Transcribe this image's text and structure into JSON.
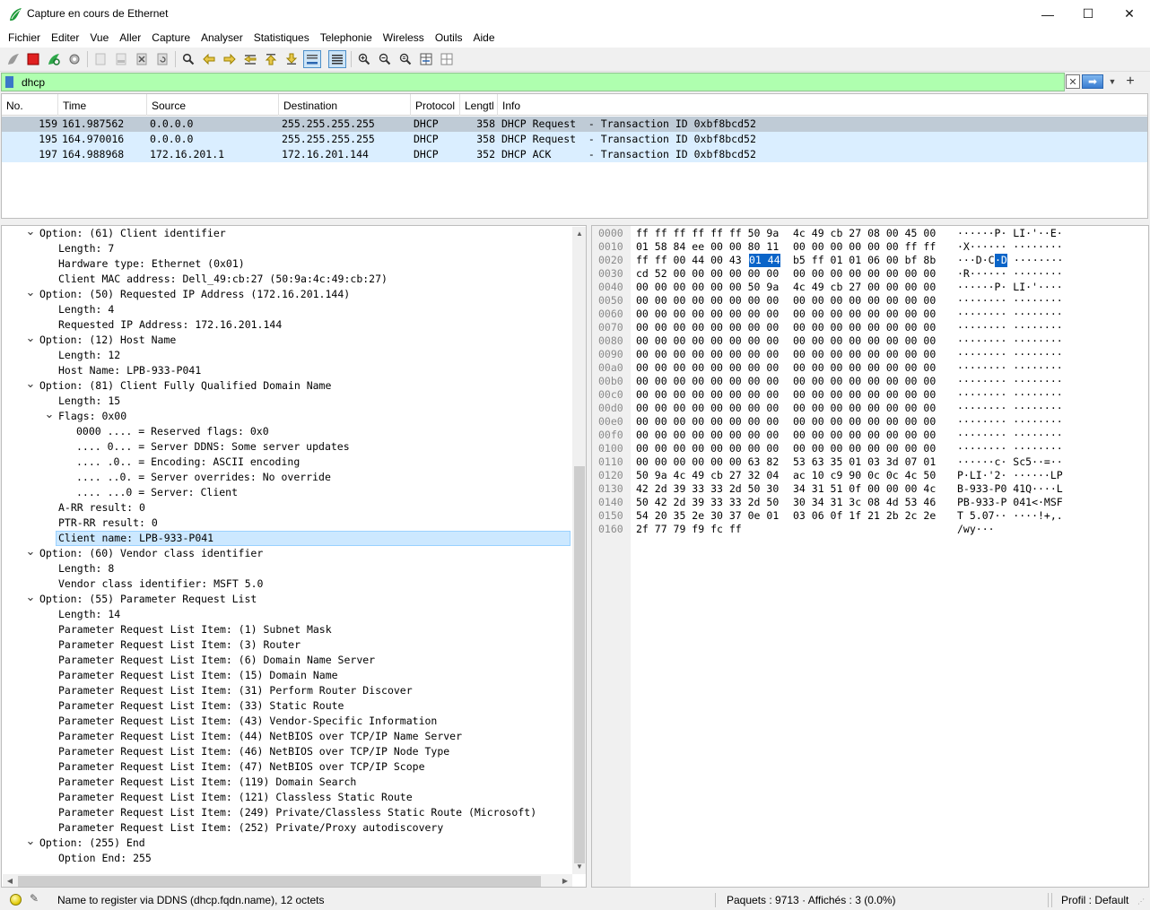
{
  "window": {
    "title": "Capture en cours de Ethernet",
    "minimize": "—",
    "maximize": "☐",
    "close": "✕"
  },
  "menu": [
    "Fichier",
    "Editer",
    "Vue",
    "Aller",
    "Capture",
    "Analyser",
    "Statistiques",
    "Telephonie",
    "Wireless",
    "Outils",
    "Aide"
  ],
  "filter": {
    "value": "dhcp",
    "background": "#afffaf"
  },
  "packet_list": {
    "columns": [
      "No.",
      "Time",
      "Source",
      "Destination",
      "Protocol",
      "Lengtl",
      "Info"
    ],
    "rows": [
      {
        "no": "159",
        "time": "161.987562",
        "source": "0.0.0.0",
        "destination": "255.255.255.255",
        "protocol": "DHCP",
        "length": "358",
        "info": "DHCP Request  - Transaction ID 0xbf8bcd52",
        "selected": true
      },
      {
        "no": "195",
        "time": "164.970016",
        "source": "0.0.0.0",
        "destination": "255.255.255.255",
        "protocol": "DHCP",
        "length": "358",
        "info": "DHCP Request  - Transaction ID 0xbf8bcd52",
        "selected": false
      },
      {
        "no": "197",
        "time": "164.988968",
        "source": "172.16.201.1",
        "destination": "172.16.201.144",
        "protocol": "DHCP",
        "length": "352",
        "info": "DHCP ACK      - Transaction ID 0xbf8bcd52",
        "selected": false
      }
    ],
    "selected_color": "#bfcbd6",
    "row_color": "#daeeff"
  },
  "details": [
    {
      "text": "Option: (61) Client identifier",
      "level": 1,
      "expander": "open"
    },
    {
      "text": "Length: 7",
      "level": 2
    },
    {
      "text": "Hardware type: Ethernet (0x01)",
      "level": 2
    },
    {
      "text": "Client MAC address: Dell_49:cb:27 (50:9a:4c:49:cb:27)",
      "level": 2
    },
    {
      "text": "Option: (50) Requested IP Address (172.16.201.144)",
      "level": 1,
      "expander": "open"
    },
    {
      "text": "Length: 4",
      "level": 2
    },
    {
      "text": "Requested IP Address: 172.16.201.144",
      "level": 2
    },
    {
      "text": "Option: (12) Host Name",
      "level": 1,
      "expander": "open"
    },
    {
      "text": "Length: 12",
      "level": 2
    },
    {
      "text": "Host Name: LPB-933-P041",
      "level": 2
    },
    {
      "text": "Option: (81) Client Fully Qualified Domain Name",
      "level": 1,
      "expander": "open"
    },
    {
      "text": "Length: 15",
      "level": 2
    },
    {
      "text": "Flags: 0x00",
      "level": 2,
      "expander": "open"
    },
    {
      "text": "0000 .... = Reserved flags: 0x0",
      "level": 3
    },
    {
      "text": ".... 0... = Server DDNS: Some server updates",
      "level": 3
    },
    {
      "text": ".... .0.. = Encoding: ASCII encoding",
      "level": 3
    },
    {
      "text": ".... ..0. = Server overrides: No override",
      "level": 3
    },
    {
      "text": ".... ...0 = Server: Client",
      "level": 3
    },
    {
      "text": "A-RR result: 0",
      "level": 2
    },
    {
      "text": "PTR-RR result: 0",
      "level": 2
    },
    {
      "text": "Client name: LPB-933-P041",
      "level": 2,
      "selected": true
    },
    {
      "text": "Option: (60) Vendor class identifier",
      "level": 1,
      "expander": "open"
    },
    {
      "text": "Length: 8",
      "level": 2
    },
    {
      "text": "Vendor class identifier: MSFT 5.0",
      "level": 2
    },
    {
      "text": "Option: (55) Parameter Request List",
      "level": 1,
      "expander": "open"
    },
    {
      "text": "Length: 14",
      "level": 2
    },
    {
      "text": "Parameter Request List Item: (1) Subnet Mask",
      "level": 2
    },
    {
      "text": "Parameter Request List Item: (3) Router",
      "level": 2
    },
    {
      "text": "Parameter Request List Item: (6) Domain Name Server",
      "level": 2
    },
    {
      "text": "Parameter Request List Item: (15) Domain Name",
      "level": 2
    },
    {
      "text": "Parameter Request List Item: (31) Perform Router Discover",
      "level": 2
    },
    {
      "text": "Parameter Request List Item: (33) Static Route",
      "level": 2
    },
    {
      "text": "Parameter Request List Item: (43) Vendor-Specific Information",
      "level": 2
    },
    {
      "text": "Parameter Request List Item: (44) NetBIOS over TCP/IP Name Server",
      "level": 2
    },
    {
      "text": "Parameter Request List Item: (46) NetBIOS over TCP/IP Node Type",
      "level": 2
    },
    {
      "text": "Parameter Request List Item: (47) NetBIOS over TCP/IP Scope",
      "level": 2
    },
    {
      "text": "Parameter Request List Item: (119) Domain Search",
      "level": 2
    },
    {
      "text": "Parameter Request List Item: (121) Classless Static Route",
      "level": 2
    },
    {
      "text": "Parameter Request List Item: (249) Private/Classless Static Route (Microsoft)",
      "level": 2
    },
    {
      "text": "Parameter Request List Item: (252) Private/Proxy autodiscovery",
      "level": 2
    },
    {
      "text": "Option: (255) End",
      "level": 1,
      "expander": "open"
    },
    {
      "text": "Option End: 255",
      "level": 2
    }
  ],
  "bytes": [
    {
      "offset": "0000",
      "hex1": "ff ff ff ff ff ff 50 9a",
      "hex2": "4c 49 cb 27 08 00 45 00",
      "ascii": "······P· LI·'··E·"
    },
    {
      "offset": "0010",
      "hex1": "01 58 84 ee 00 00 80 11",
      "hex2": "00 00 00 00 00 00 ff ff",
      "ascii": "·X······ ········"
    },
    {
      "offset": "0020",
      "hex1": "ff ff 00 44 00 43",
      "hl_hex": "01 44",
      "hex2": "b5 ff 01 01 06 00 bf 8b",
      "ascii_pre": "···D·C",
      "ascii_hl": "·D",
      "ascii_post": " ········"
    },
    {
      "offset": "0030",
      "hex1": "cd 52 00 00 00 00 00 00",
      "hex2": "00 00 00 00 00 00 00 00",
      "ascii": "·R······ ········"
    },
    {
      "offset": "0040",
      "hex1": "00 00 00 00 00 00 50 9a",
      "hex2": "4c 49 cb 27 00 00 00 00",
      "ascii": "······P· LI·'····"
    },
    {
      "offset": "0050",
      "hex1": "00 00 00 00 00 00 00 00",
      "hex2": "00 00 00 00 00 00 00 00",
      "ascii": "········ ········"
    },
    {
      "offset": "0060",
      "hex1": "00 00 00 00 00 00 00 00",
      "hex2": "00 00 00 00 00 00 00 00",
      "ascii": "········ ········"
    },
    {
      "offset": "0070",
      "hex1": "00 00 00 00 00 00 00 00",
      "hex2": "00 00 00 00 00 00 00 00",
      "ascii": "········ ········"
    },
    {
      "offset": "0080",
      "hex1": "00 00 00 00 00 00 00 00",
      "hex2": "00 00 00 00 00 00 00 00",
      "ascii": "········ ········"
    },
    {
      "offset": "0090",
      "hex1": "00 00 00 00 00 00 00 00",
      "hex2": "00 00 00 00 00 00 00 00",
      "ascii": "········ ········"
    },
    {
      "offset": "00a0",
      "hex1": "00 00 00 00 00 00 00 00",
      "hex2": "00 00 00 00 00 00 00 00",
      "ascii": "········ ········"
    },
    {
      "offset": "00b0",
      "hex1": "00 00 00 00 00 00 00 00",
      "hex2": "00 00 00 00 00 00 00 00",
      "ascii": "········ ········"
    },
    {
      "offset": "00c0",
      "hex1": "00 00 00 00 00 00 00 00",
      "hex2": "00 00 00 00 00 00 00 00",
      "ascii": "········ ········"
    },
    {
      "offset": "00d0",
      "hex1": "00 00 00 00 00 00 00 00",
      "hex2": "00 00 00 00 00 00 00 00",
      "ascii": "········ ········"
    },
    {
      "offset": "00e0",
      "hex1": "00 00 00 00 00 00 00 00",
      "hex2": "00 00 00 00 00 00 00 00",
      "ascii": "········ ········"
    },
    {
      "offset": "00f0",
      "hex1": "00 00 00 00 00 00 00 00",
      "hex2": "00 00 00 00 00 00 00 00",
      "ascii": "········ ········"
    },
    {
      "offset": "0100",
      "hex1": "00 00 00 00 00 00 00 00",
      "hex2": "00 00 00 00 00 00 00 00",
      "ascii": "········ ········"
    },
    {
      "offset": "0110",
      "hex1": "00 00 00 00 00 00 63 82",
      "hex2": "53 63 35 01 03 3d 07 01",
      "ascii": "······c· Sc5··=··"
    },
    {
      "offset": "0120",
      "hex1": "50 9a 4c 49 cb 27 32 04",
      "hex2": "ac 10 c9 90 0c 0c 4c 50",
      "ascii": "P·LI·'2· ······LP"
    },
    {
      "offset": "0130",
      "hex1": "42 2d 39 33 33 2d 50 30",
      "hex2": "34 31 51 0f 00 00 00 4c",
      "ascii": "B-933-P0 41Q····L"
    },
    {
      "offset": "0140",
      "hex1": "50 42 2d 39 33 33 2d 50",
      "hex2": "30 34 31 3c 08 4d 53 46",
      "ascii": "PB-933-P 041<·MSF"
    },
    {
      "offset": "0150",
      "hex1": "54 20 35 2e 30 37 0e 01",
      "hex2": "03 06 0f 1f 21 2b 2c 2e",
      "ascii": "T 5.07·· ····!+,."
    },
    {
      "offset": "0160",
      "hex1": "2f 77 79 f9 fc ff",
      "hex2": "",
      "ascii": "/wy···"
    }
  ],
  "status": {
    "message": "Name to register via DDNS (dhcp.fqdn.name), 12 octets",
    "packets": "Paquets : 9713 · Affichés : 3 (0.0%)",
    "profile": "Profil : Default"
  }
}
